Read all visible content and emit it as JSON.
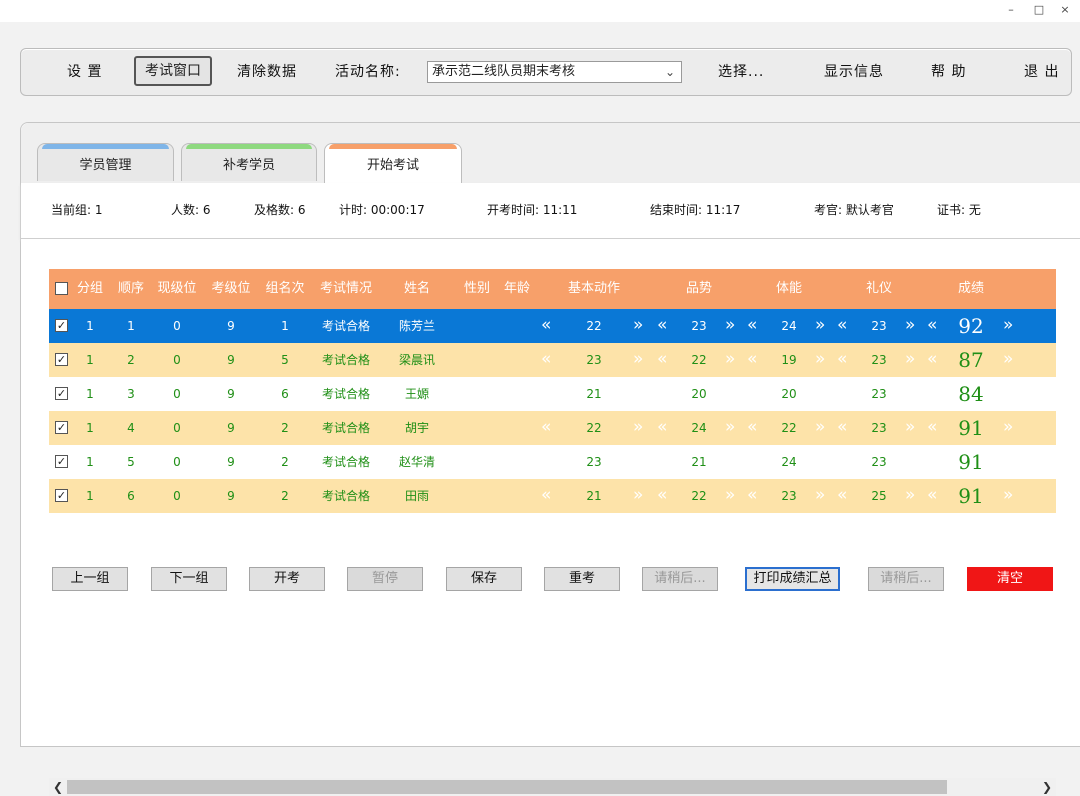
{
  "window": {
    "controls": [
      "–",
      "□",
      "×"
    ]
  },
  "toolbar": {
    "settings": "设 置",
    "exam_window": "考试窗口",
    "clear_data": "清除数据",
    "activity_label": "活动名称:",
    "activity_value": "承示范二线队员期末考核",
    "select": "选择...",
    "show_info": "显示信息",
    "help": "帮 助",
    "exit": "退 出"
  },
  "tabs": [
    {
      "label": "学员管理",
      "color": "#7fb5e8"
    },
    {
      "label": "补考学员",
      "color": "#8ed97f"
    },
    {
      "label": "开始考试",
      "color": "#f7a06a"
    }
  ],
  "info": {
    "group": "当前组: 1",
    "count": "人数: 6",
    "passed": "及格数: 6",
    "timer": "计时: 00:00:17",
    "start": "开考时间: 11:11",
    "end": "结束时间: 11:17",
    "examiner": "考官: 默认考官",
    "certificate": "证书: 无"
  },
  "columns": [
    "分组",
    "顺序",
    "现级位",
    "考级位",
    "组名次",
    "考试情况",
    "姓名",
    "性别",
    "年龄",
    "基本动作",
    "品势",
    "体能",
    "礼仪",
    "成绩"
  ],
  "rows": [
    {
      "checked": "✓",
      "group": "1",
      "order": "1",
      "cur": "0",
      "target": "9",
      "rank": "1",
      "status": "考试合格",
      "name": "陈芳兰",
      "s1": "22",
      "s2": "23",
      "s3": "24",
      "s4": "23",
      "score": "92"
    },
    {
      "checked": "✓",
      "group": "1",
      "order": "2",
      "cur": "0",
      "target": "9",
      "rank": "5",
      "status": "考试合格",
      "name": "梁晨讯",
      "s1": "23",
      "s2": "22",
      "s3": "19",
      "s4": "23",
      "score": "87"
    },
    {
      "checked": "✓",
      "group": "1",
      "order": "3",
      "cur": "0",
      "target": "9",
      "rank": "6",
      "status": "考试合格",
      "name": "王嫄",
      "s1": "21",
      "s2": "20",
      "s3": "20",
      "s4": "23",
      "score": "84"
    },
    {
      "checked": "✓",
      "group": "1",
      "order": "4",
      "cur": "0",
      "target": "9",
      "rank": "2",
      "status": "考试合格",
      "name": "胡宇",
      "s1": "22",
      "s2": "24",
      "s3": "22",
      "s4": "23",
      "score": "91"
    },
    {
      "checked": "✓",
      "group": "1",
      "order": "5",
      "cur": "0",
      "target": "9",
      "rank": "2",
      "status": "考试合格",
      "name": "赵华清",
      "s1": "23",
      "s2": "21",
      "s3": "24",
      "s4": "23",
      "score": "91"
    },
    {
      "checked": "✓",
      "group": "1",
      "order": "6",
      "cur": "0",
      "target": "9",
      "rank": "2",
      "status": "考试合格",
      "name": "田雨",
      "s1": "21",
      "s2": "22",
      "s3": "23",
      "s4": "25",
      "score": "91"
    }
  ],
  "arrows": {
    "left": "«",
    "right": "»"
  },
  "buttons": {
    "prev": "上一组",
    "next": "下一组",
    "start": "开考",
    "pause": "暂停",
    "save": "保存",
    "retest": "重考",
    "wait1": "请稍后...",
    "print": "打印成绩汇总",
    "wait2": "请稍后...",
    "clear": "清空"
  },
  "colors": {
    "header": "#f7a06a",
    "selected_row": "#0a78d6",
    "alt_row": "#fde3a9",
    "green_text": "#1f8f16",
    "blue_text": "#1a4f9e",
    "danger": "#f01616"
  }
}
